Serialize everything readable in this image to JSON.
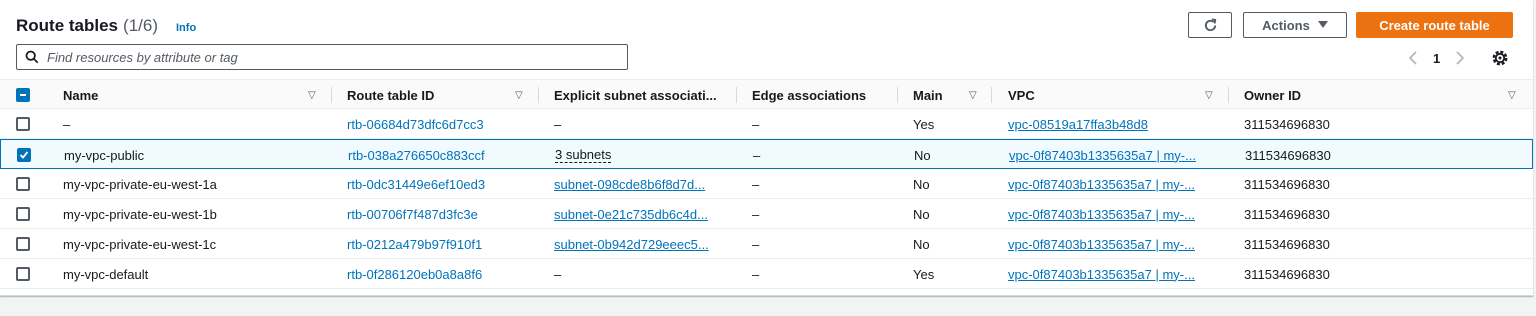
{
  "header": {
    "title": "Route tables",
    "count": "(1/6)",
    "info": "Info"
  },
  "toolbar": {
    "actions_label": "Actions",
    "create_label": "Create route table",
    "search_placeholder": "Find resources by attribute or tag"
  },
  "pagination": {
    "current_page": "1"
  },
  "columns": {
    "name": "Name",
    "route_table_id": "Route table ID",
    "explicit_subnet": "Explicit subnet associati...",
    "edge": "Edge associations",
    "main": "Main",
    "vpc": "VPC",
    "owner": "Owner ID"
  },
  "rows": [
    {
      "name": "–",
      "route_table_id": "rtb-06684d73dfc6d7cc3",
      "subnet": "–",
      "edge": "–",
      "main": "Yes",
      "vpc": "vpc-08519a17ffa3b48d8",
      "owner": "311534696830",
      "checked": false
    },
    {
      "name": "my-vpc-public",
      "route_table_id": "rtb-038a276650c883ccf",
      "subnet": "3 subnets",
      "edge": "–",
      "main": "No",
      "vpc": "vpc-0f87403b1335635a7 | my-...",
      "owner": "311534696830",
      "checked": true
    },
    {
      "name": "my-vpc-private-eu-west-1a",
      "route_table_id": "rtb-0dc31449e6ef10ed3",
      "subnet": "subnet-098cde8b6f8d7d...",
      "edge": "–",
      "main": "No",
      "vpc": "vpc-0f87403b1335635a7 | my-...",
      "owner": "311534696830",
      "checked": false
    },
    {
      "name": "my-vpc-private-eu-west-1b",
      "route_table_id": "rtb-00706f7f487d3fc3e",
      "subnet": "subnet-0e21c735db6c4d...",
      "edge": "–",
      "main": "No",
      "vpc": "vpc-0f87403b1335635a7 | my-...",
      "owner": "311534696830",
      "checked": false
    },
    {
      "name": "my-vpc-private-eu-west-1c",
      "route_table_id": "rtb-0212a479b97f910f1",
      "subnet": "subnet-0b942d729eeec5...",
      "edge": "–",
      "main": "No",
      "vpc": "vpc-0f87403b1335635a7 | my-...",
      "owner": "311534696830",
      "checked": false
    },
    {
      "name": "my-vpc-default",
      "route_table_id": "rtb-0f286120eb0a8a8f6",
      "subnet": "–",
      "edge": "–",
      "main": "Yes",
      "vpc": "vpc-0f87403b1335635a7 | my-...",
      "owner": "311534696830",
      "checked": false
    }
  ],
  "colors": {
    "link": "#0073bb",
    "primary": "#ec7211",
    "selected_bg": "#f1faff"
  }
}
